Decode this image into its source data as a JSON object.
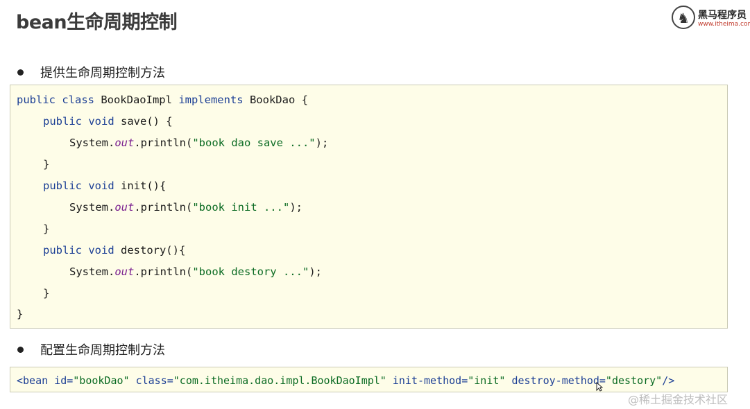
{
  "title": "bean生命周期控制",
  "logo": {
    "brand": "黑马程序员",
    "url": "www.itheima.com"
  },
  "bullets": [
    "提供生命周期控制方法",
    "配置生命周期控制方法"
  ],
  "code1": {
    "l1": {
      "kw": "public class",
      "mid": " BookDaoImpl ",
      "kw2": "implements",
      "rest": " BookDao {"
    },
    "l2": {
      "kw": "public void",
      "rest": " save() {"
    },
    "l3": {
      "a": "System.",
      "fld": "out",
      "b": ".println(",
      "str": "\"book dao save ...\"",
      "c": ");"
    },
    "l4": "}",
    "l5": {
      "kw": "public void",
      "rest": " init(){"
    },
    "l6": {
      "a": "System.",
      "fld": "out",
      "b": ".println(",
      "str": "\"book init ...\"",
      "c": ");"
    },
    "l7": "}",
    "l8": {
      "kw": "public void",
      "rest": " destory(){"
    },
    "l9": {
      "a": "System.",
      "fld": "out",
      "b": ".println(",
      "str": "\"book destory ...\"",
      "c": ");"
    },
    "l10": "}",
    "l11": "}"
  },
  "code2": {
    "tag": "<bean",
    "a1": " id=",
    "v1": "\"bookDao\"",
    "a2": " class=",
    "v2": "\"com.itheima.dao.impl.BookDaoImpl\"",
    "a3": " init-method=",
    "v3": "\"init\"",
    "a4": " destroy-method=",
    "v4": "\"destory\"",
    "end": "/>"
  },
  "watermark": "@稀土掘金技术社区",
  "colors": {
    "code_bg": "#fefde8",
    "keyword": "#1c3f95",
    "string": "#0b6b23",
    "field": "#7a1f8f"
  }
}
